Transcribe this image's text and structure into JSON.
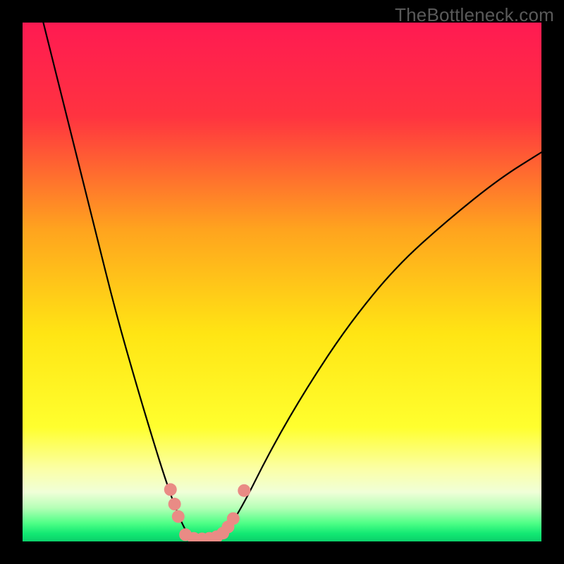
{
  "watermark": "TheBottleneck.com",
  "chart_data": {
    "type": "line",
    "title": "",
    "xlabel": "",
    "ylabel": "",
    "xlim": [
      0,
      100
    ],
    "ylim": [
      0,
      100
    ],
    "gradient_stops": [
      {
        "offset": 0.0,
        "color": "#ff1a52"
      },
      {
        "offset": 0.18,
        "color": "#ff3340"
      },
      {
        "offset": 0.4,
        "color": "#ffa41e"
      },
      {
        "offset": 0.6,
        "color": "#ffe514"
      },
      {
        "offset": 0.78,
        "color": "#ffff2e"
      },
      {
        "offset": 0.86,
        "color": "#fbffa6"
      },
      {
        "offset": 0.905,
        "color": "#f0ffd8"
      },
      {
        "offset": 0.935,
        "color": "#b6ffb7"
      },
      {
        "offset": 0.965,
        "color": "#4eff86"
      },
      {
        "offset": 0.985,
        "color": "#12e873"
      },
      {
        "offset": 1.0,
        "color": "#0bd06a"
      }
    ],
    "series": [
      {
        "name": "left-curve",
        "type": "line",
        "color": "#000000",
        "points": [
          {
            "x": 4.0,
            "y": 100.0
          },
          {
            "x": 9.0,
            "y": 80.0
          },
          {
            "x": 14.0,
            "y": 60.0
          },
          {
            "x": 18.0,
            "y": 44.0
          },
          {
            "x": 22.0,
            "y": 30.0
          },
          {
            "x": 25.0,
            "y": 20.0
          },
          {
            "x": 27.5,
            "y": 12.0
          },
          {
            "x": 30.0,
            "y": 5.0
          },
          {
            "x": 32.0,
            "y": 1.0
          }
        ]
      },
      {
        "name": "right-curve",
        "type": "line",
        "color": "#000000",
        "points": [
          {
            "x": 38.5,
            "y": 1.0
          },
          {
            "x": 42.0,
            "y": 6.0
          },
          {
            "x": 48.0,
            "y": 18.0
          },
          {
            "x": 55.0,
            "y": 30.0
          },
          {
            "x": 63.0,
            "y": 42.0
          },
          {
            "x": 72.0,
            "y": 53.0
          },
          {
            "x": 82.0,
            "y": 62.0
          },
          {
            "x": 92.0,
            "y": 70.0
          },
          {
            "x": 100.0,
            "y": 75.0
          }
        ]
      },
      {
        "name": "valley-dots",
        "type": "scatter",
        "color": "#e98b85",
        "points": [
          {
            "x": 28.5,
            "y": 10.0
          },
          {
            "x": 29.3,
            "y": 7.2
          },
          {
            "x": 30.0,
            "y": 4.8
          },
          {
            "x": 31.4,
            "y": 1.3
          },
          {
            "x": 33.0,
            "y": 0.6
          },
          {
            "x": 34.6,
            "y": 0.5
          },
          {
            "x": 36.0,
            "y": 0.6
          },
          {
            "x": 37.4,
            "y": 0.9
          },
          {
            "x": 38.6,
            "y": 1.6
          },
          {
            "x": 39.6,
            "y": 2.8
          },
          {
            "x": 40.6,
            "y": 4.4
          },
          {
            "x": 42.7,
            "y": 9.8
          }
        ]
      }
    ]
  }
}
